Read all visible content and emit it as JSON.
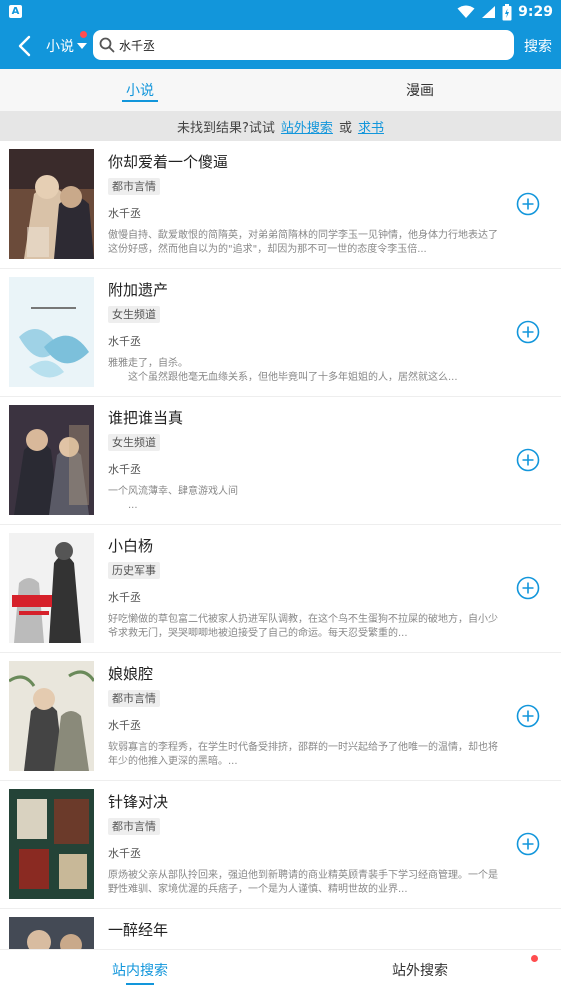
{
  "status_bar": {
    "app_badge": "A",
    "time": "9:29"
  },
  "app_bar": {
    "category_label": "小说",
    "search_value": "水千丞",
    "search_button": "搜索"
  },
  "tabs": [
    {
      "label": "小说",
      "selected": true
    },
    {
      "label": "漫画",
      "selected": false
    }
  ],
  "hint": {
    "prefix": "未找到结果?试试",
    "link_external": "站外搜索",
    "or": "或",
    "link_request": "求书"
  },
  "books": [
    {
      "title": "你却爱着一个傻逼",
      "tag": "都市言情",
      "author": "水千丞",
      "desc": "傲慢自持、歃爱敢恨的简隋英，对弟弟简隋林的同学李玉一见钟情，他身体力行地表达了这份好感，然而他自以为的\"追求\"，却因为那不可一世的态度令李玉倍..."
    },
    {
      "title": "附加遗产",
      "tag": "女生频道",
      "author": "水千丞",
      "desc": "雅雅走了，自杀。\n　　这个虽然跟他毫无血缘关系，但他毕竟叫了十多年姐姐的人，居然就这么..."
    },
    {
      "title": "谁把谁当真",
      "tag": "女生频道",
      "author": "水千丞",
      "desc": "一个风流薄幸、肆意游戏人间\n　　..."
    },
    {
      "title": "小白杨",
      "tag": "历史军事",
      "author": "水千丞",
      "desc": "好吃懒做的草包富二代被家人扔进军队调教，在这个鸟不生蛋狗不拉屎的破地方，自小少爷求救无门，哭哭唧唧地被迫接受了自己的命运。每天忍受繁重的..."
    },
    {
      "title": "娘娘腔",
      "tag": "都市言情",
      "author": "水千丞",
      "desc": "软弱寡言的李程秀，在学生时代备受排挤，邵群的一时兴起给予了他唯一的温情，却也将年少的他推入更深的黑暗。..."
    },
    {
      "title": "针锋对决",
      "tag": "都市言情",
      "author": "水千丞",
      "desc": "原炀被父亲从部队拎回来，强迫他到新聘请的商业精英顾青裴手下学习经商管理。一个是野性难驯、家境优渥的兵痞子，一个是为人谨慎、精明世故的业界..."
    },
    {
      "title": "一醉经年",
      "tag": "",
      "author": "",
      "desc": ""
    }
  ],
  "bottom_nav": [
    {
      "label": "站内搜索",
      "selected": true
    },
    {
      "label": "站外搜索",
      "selected": false
    }
  ],
  "colors": {
    "accent": "#1296db",
    "badge": "#ff4d4f"
  }
}
